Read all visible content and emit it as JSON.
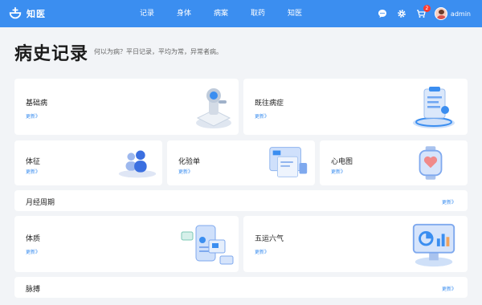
{
  "app": {
    "name": "知医"
  },
  "nav": [
    "记录",
    "身体",
    "病案",
    "取药",
    "知医"
  ],
  "user": {
    "name": "admin",
    "cart_count": "2"
  },
  "page": {
    "title": "病史记录",
    "subtitle": "何以为病？平日记录，平均为常，异常者病。"
  },
  "link_text": "更新》",
  "cards": {
    "jichubing": "基础病",
    "jiwang": "既往病症",
    "tizheng": "体征",
    "huayan": "化验单",
    "xindian": "心电图",
    "yuejing": "月经周期",
    "tizhi": "体质",
    "wuyun": "五运六气",
    "maibo": "脉搏"
  },
  "colors": {
    "primary": "#3b8ef0",
    "background": "#f2f4f7",
    "card": "#ffffff"
  }
}
